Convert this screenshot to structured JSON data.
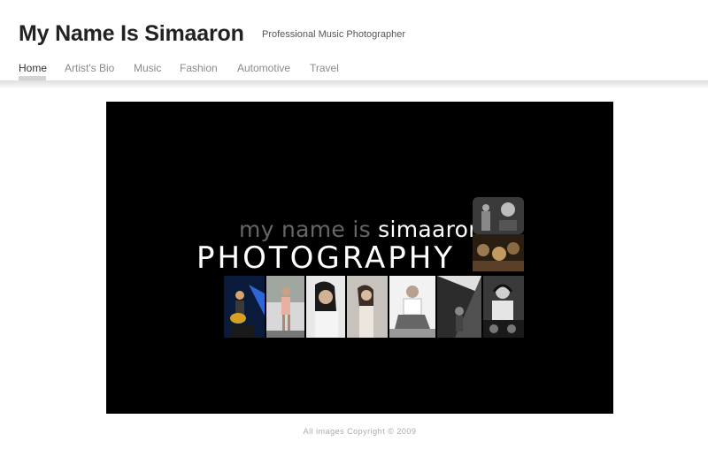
{
  "site": {
    "title": "My Name Is Simaaron",
    "tagline": "Professional Music Photographer"
  },
  "nav": {
    "items": [
      {
        "label": "Home",
        "active": true
      },
      {
        "label": "Artist's Bio"
      },
      {
        "label": "Music"
      },
      {
        "label": "Fashion"
      },
      {
        "label": "Automotive"
      },
      {
        "label": "Travel"
      }
    ]
  },
  "hero": {
    "line1_prefix": "my name is ",
    "line1_name": "simaaron",
    "line2": "PHOTOGRAPHY"
  },
  "footer": {
    "copyright": "All images Copyright © 2009"
  },
  "colors": {
    "accent": "#333333",
    "nav_inactive": "#8a8a8a",
    "hero_bg": "#000000"
  }
}
